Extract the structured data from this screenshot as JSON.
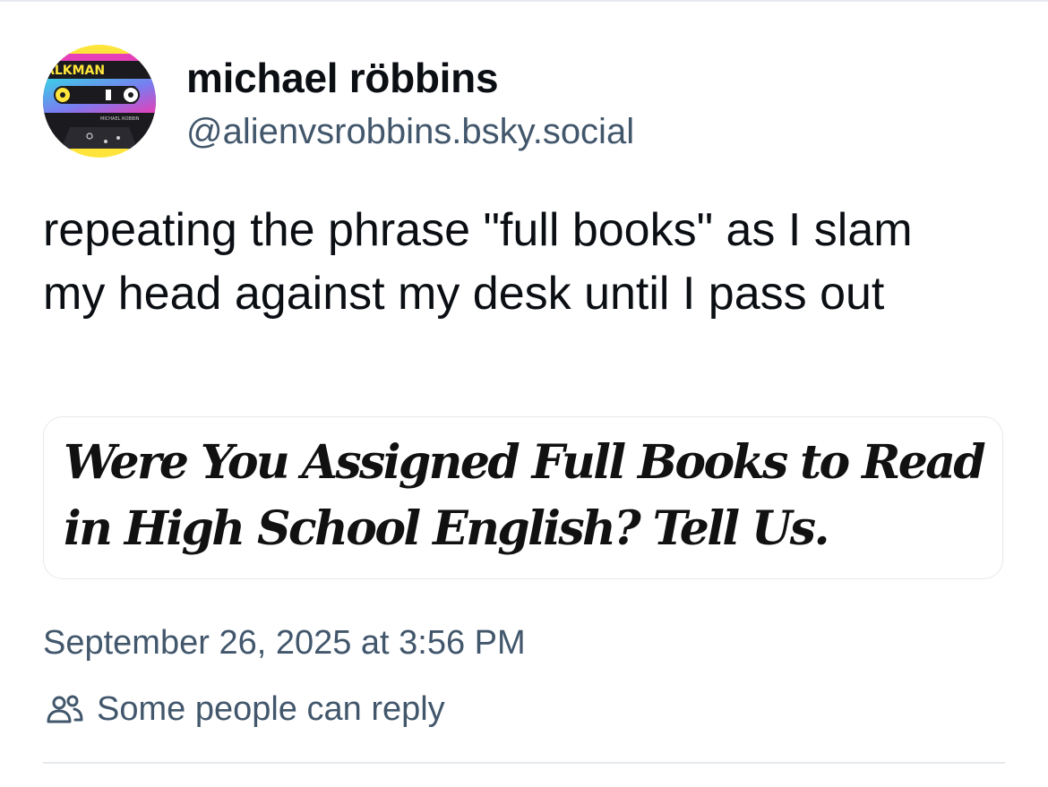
{
  "author": {
    "display_name": "michael röbbins",
    "handle": "@alienvsrobbins.bsky.social",
    "avatar": {
      "icon": "cassette-tape-avatar",
      "brand_text": "ALKMAN",
      "label_text": "MICHAEL ROBBIN",
      "colors": {
        "pink": "#e540b8",
        "cyan": "#39d0e6",
        "yellow": "#ffe53b",
        "dark": "#1b1b1f"
      }
    }
  },
  "post": {
    "text": "repeating the phrase \"full books\" as I slam my head against my desk until I pass out"
  },
  "embed": {
    "headline_line1": "Were You Assigned Full Books to Read",
    "headline_line2": "in High School English? Tell Us."
  },
  "meta": {
    "timestamp": "September 26, 2025 at 3:56 PM",
    "reply_setting": "Some people can reply",
    "reply_icon": "people-icon"
  },
  "colors": {
    "text_primary": "#0b0f14",
    "text_secondary": "#42576c",
    "border": "#e6e9ed"
  }
}
